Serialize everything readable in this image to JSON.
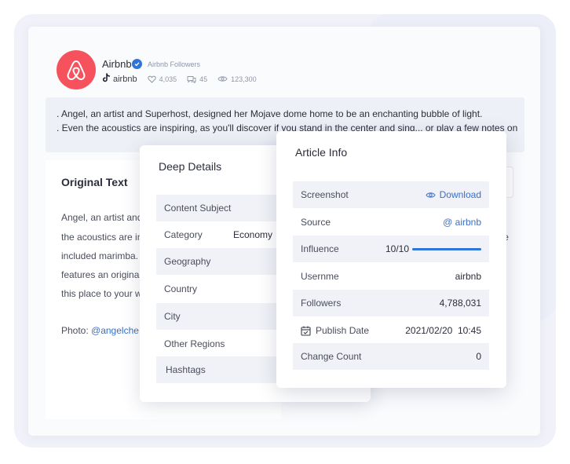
{
  "account": {
    "name": "Airbnb",
    "followers_label": "Airbnb Followers",
    "tiktok_handle": "airbnb",
    "likes": "4,035",
    "comments": "45",
    "views": "123,300",
    "brand_color": "#f6525d",
    "verified_color": "#2f74d9"
  },
  "post": {
    "line1": ". Angel, an artist and Superhost, designed her Mojave dome home to be an enchanting bubble of light.",
    "line2": ". Even the acoustics are inspiring, as you'll discover if you stand in the center and sing... or play a few notes on"
  },
  "original": {
    "title": "Original Text",
    "lines": [
      "Angel, an artist and Superhost, designed her Mojave dome home to be an enchanting bubble of light. Even",
      "the acoustics are inspiring, as you'll discover if you stand in the center and sing... or play a few notes on the",
      "included marimba. Other unique",
      "features an original",
      "this place to your wishlist"
    ],
    "photo_label": "Photo: ",
    "photo_handle": "@angelche"
  },
  "deep_details": {
    "title": "Deep Details",
    "rows": [
      {
        "label": "Content Subject",
        "value": ""
      },
      {
        "label": "Category",
        "value": "Economy"
      },
      {
        "label": "Geography",
        "value": ""
      },
      {
        "label": "Country",
        "value": ""
      },
      {
        "label": "City",
        "value": ""
      },
      {
        "label": "Other Regions",
        "value": ""
      },
      {
        "label": "Hashtags",
        "value": ""
      }
    ]
  },
  "article_info": {
    "title": "Article Info",
    "screenshot_label": "Screenshot",
    "download_label": "Download",
    "source_label": "Source",
    "source_value": "@ airbnb",
    "influence_label": "Influence",
    "influence_value": "10/10",
    "influence_fraction": 1.0,
    "username_label": "Usernme",
    "username_value": "airbnb",
    "followers_label": "Followers",
    "followers_value": "4,788,031",
    "publish_label": "Publish Date",
    "publish_value": "2021/02/20  10:45",
    "change_label": "Change Count",
    "change_value": "0",
    "link_color": "#3a6fc4"
  }
}
